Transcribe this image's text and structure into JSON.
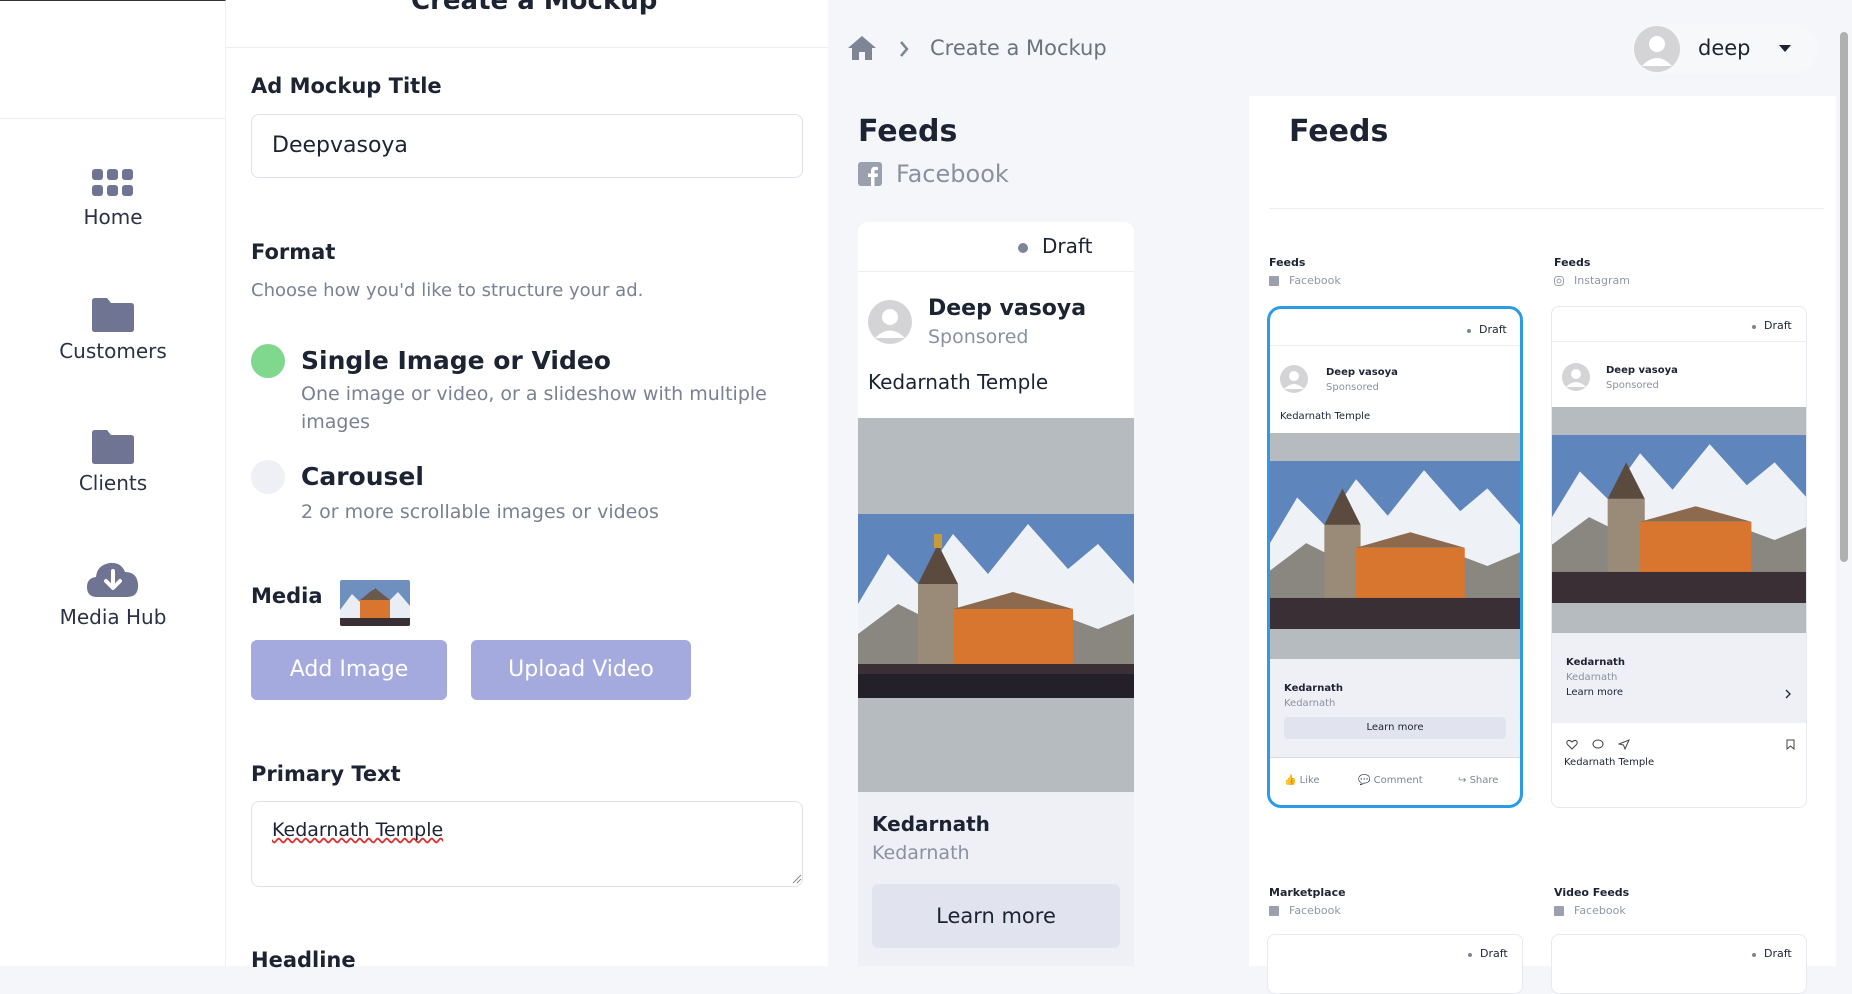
{
  "app": {
    "page_title": "Create a Mockup"
  },
  "sidebar": {
    "items": [
      {
        "label": "Home",
        "icon": "grid-icon"
      },
      {
        "label": "Customers",
        "icon": "folder-icon"
      },
      {
        "label": "Clients",
        "icon": "folder-icon"
      },
      {
        "label": "Media Hub",
        "icon": "cloud-download-icon"
      }
    ]
  },
  "form": {
    "title_label": "Ad Mockup Title",
    "title_value": "Deepvasoya",
    "format_label": "Format",
    "format_hint": "Choose how you'd like to structure your ad.",
    "options": [
      {
        "title": "Single Image or Video",
        "desc": "One image or video, or a slideshow with multiple images",
        "selected": true
      },
      {
        "title": "Carousel",
        "desc": "2 or more scrollable images or videos",
        "selected": false
      }
    ],
    "media_label": "Media",
    "add_image": "Add Image",
    "upload_video": "Upload Video",
    "primary_label": "Primary Text",
    "primary_value": "Kedarnath Temple",
    "headline_label": "Headline"
  },
  "topbar": {
    "breadcrumb": "Create a Mockup",
    "user": "deep"
  },
  "preview": {
    "heading": "Feeds",
    "platform": "Facebook",
    "status": "Draft",
    "author": "Deep vasoya",
    "sponsored": "Sponsored",
    "text": "Kedarnath Temple",
    "link_title": "Kedarnath",
    "link_sub": "Kedarnath",
    "cta": "Learn more"
  },
  "right": {
    "heading": "Feeds",
    "cards": [
      {
        "section": "Feeds",
        "platform": "Facebook",
        "status": "Draft",
        "author": "Deep vasoya",
        "sponsored": "Sponsored",
        "text": "Kedarnath Temple",
        "link_title": "Kedarnath",
        "link_sub": "Kedarnath",
        "cta": "Learn more",
        "actions": [
          "Like",
          "Comment",
          "Share"
        ]
      },
      {
        "section": "Feeds",
        "platform": "Instagram",
        "status": "Draft",
        "author": "Deep vasoya",
        "sponsored": "Sponsored",
        "link_title": "Kedarnath",
        "link_sub": "Kedarnath",
        "cta": "Learn more",
        "caption": "Kedarnath Temple"
      },
      {
        "section": "Marketplace",
        "platform": "Facebook",
        "status": "Draft"
      },
      {
        "section": "Video Feeds",
        "platform": "Facebook",
        "status": "Draft"
      }
    ]
  },
  "colors": {
    "accent": "#a4a9de",
    "selected_radio": "#7fd88e",
    "selected_card": "#2b9be8",
    "nav_icon": "#6e7491"
  }
}
